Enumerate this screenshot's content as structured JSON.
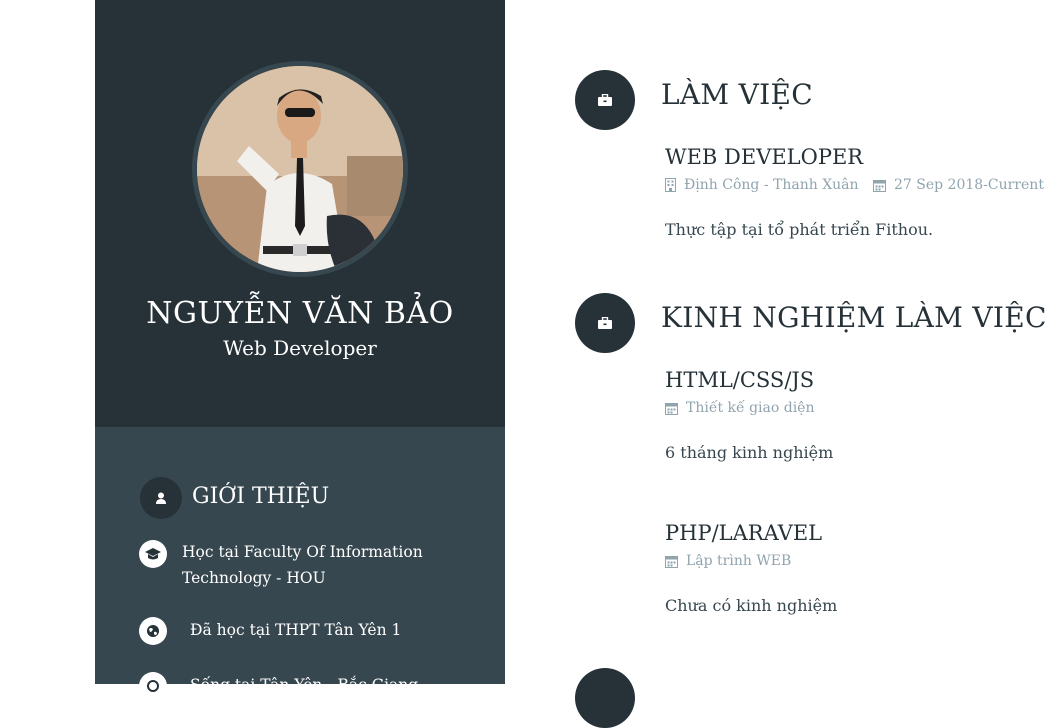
{
  "profile": {
    "name": "NGUYỄN VĂN BẢO",
    "role": "Web Developer"
  },
  "intro": {
    "title": "GIỚI THIỆU",
    "items": [
      {
        "icon": "graduation-cap-icon",
        "line1": "Học tại Faculty Of Information",
        "line2": "Technology - HOU"
      },
      {
        "icon": "globe-icon",
        "line1": "Đã học tại THPT Tân Yên 1"
      },
      {
        "icon": "location-icon",
        "line1": "Sống tại Tân Yên - Bắc Giang"
      }
    ]
  },
  "work": {
    "title": "LÀM VIỆC",
    "icon": "briefcase-icon",
    "items": [
      {
        "title": "WEB DEVELOPER",
        "location": "Định Công - Thanh Xuân",
        "date": "27 Sep 2018-Current",
        "description": "Thực tập tại tổ phát triển Fithou."
      }
    ]
  },
  "experience": {
    "title": "KINH NGHIỆM LÀM VIỆC",
    "icon": "briefcase-icon",
    "items": [
      {
        "title": "HTML/CSS/JS",
        "tag": "Thiết kế giao diện",
        "description": "6 tháng kinh nghiệm"
      },
      {
        "title": "PHP/LARAVEL",
        "tag": "Lập trình WEB",
        "description": "Chưa có kinh nghiệm"
      }
    ]
  },
  "colors": {
    "sidebar_dark": "#263238",
    "sidebar_mid": "#37474f",
    "muted": "#90a4ae"
  }
}
